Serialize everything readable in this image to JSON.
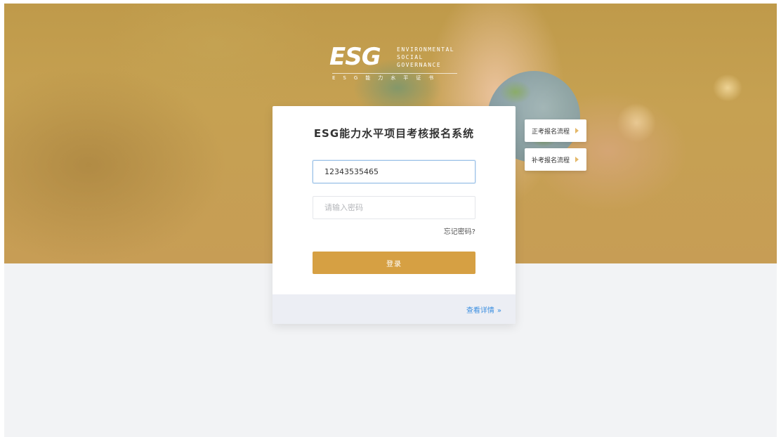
{
  "logo": {
    "mark": "ESG",
    "words": [
      "ENVIRONMENTAL",
      "SOCIAL",
      "GOVERNANCE"
    ],
    "subtitle": "ESG能力水平证书"
  },
  "login": {
    "title": "ESG能力水平项目考核报名系统",
    "username_value": "12343535465",
    "password_placeholder": "请输入密码",
    "forgot_label": "忘记密码?",
    "submit_label": "登录",
    "details_label": "查看详情",
    "details_chevron": "»"
  },
  "side_menu": {
    "items": [
      {
        "label": "正考报名流程",
        "icon": "triangle-right-icon"
      },
      {
        "label": "补考报名流程",
        "icon": "triangle-right-icon"
      }
    ]
  },
  "colors": {
    "accent": "#d6a043",
    "link": "#3b8fe0",
    "page_background": "#f2f3f5",
    "footer_background": "#eceef4"
  }
}
